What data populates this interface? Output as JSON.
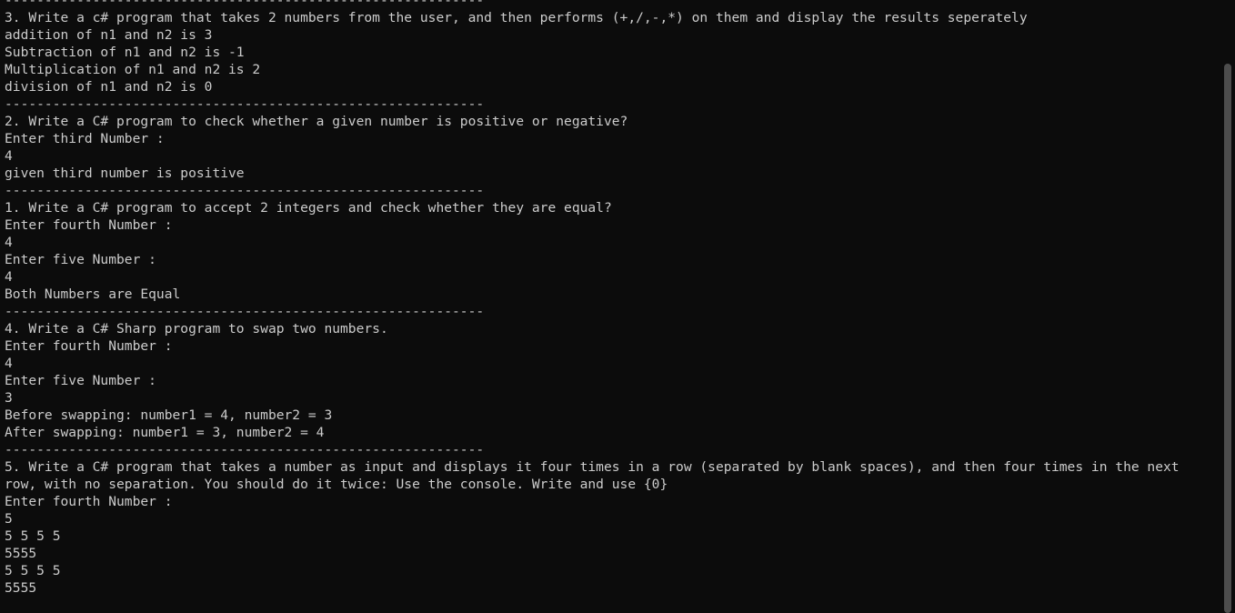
{
  "console": {
    "lines": [
      "------------------------------------------------------------",
      "3. Write a c# program that takes 2 numbers from the user, and then performs (+,/,-,*) on them and display the results seperately",
      "addition of n1 and n2 is 3",
      "Subtraction of n1 and n2 is -1",
      "Multiplication of n1 and n2 is 2",
      "division of n1 and n2 is 0",
      "------------------------------------------------------------",
      "2. Write a C# program to check whether a given number is positive or negative?",
      "Enter third Number :",
      "4",
      "given third number is positive",
      "------------------------------------------------------------",
      "1. Write a C# program to accept 2 integers and check whether they are equal?",
      "Enter fourth Number :",
      "4",
      "Enter five Number :",
      "4",
      "Both Numbers are Equal",
      "------------------------------------------------------------",
      "4. Write a C# Sharp program to swap two numbers.",
      "Enter fourth Number :",
      "4",
      "Enter five Number :",
      "3",
      "Before swapping: number1 = 4, number2 = 3",
      "After swapping: number1 = 3, number2 = 4",
      "------------------------------------------------------------",
      "5. Write a C# program that takes a number as input and displays it four times in a row (separated by blank spaces), and then four times in the next",
      "row, with no separation. You should do it twice: Use the console. Write and use {0}",
      "Enter fourth Number :",
      "5",
      "5 5 5 5",
      "5555",
      "5 5 5 5",
      "5555"
    ]
  },
  "colors": {
    "background": "#0c0c0c",
    "text": "#cccccc",
    "scrollbar_thumb": "#4d4d4d"
  }
}
